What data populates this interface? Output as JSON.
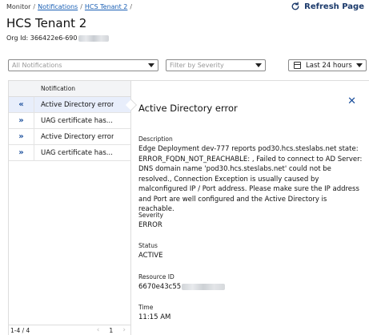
{
  "breadcrumb": {
    "items": [
      "Monitor",
      "Notifications",
      "HCS Tenant 2"
    ],
    "trailing_sep": "/"
  },
  "header": {
    "refresh_label": "Refresh Page",
    "title": "HCS Tenant 2",
    "org_id_label": "Org Id:",
    "org_id_value": "366422e6-690"
  },
  "filters": {
    "notifications_placeholder": "All Notifications",
    "severity_placeholder": "Filter by Severity",
    "time_range": "Last 24 hours"
  },
  "list": {
    "header": "Notification",
    "rows": [
      {
        "label": "Active Directory error",
        "expanded": true
      },
      {
        "label": "UAG certificate has...",
        "expanded": false
      },
      {
        "label": "Active Directory error",
        "expanded": false
      },
      {
        "label": "UAG certificate has...",
        "expanded": false
      }
    ],
    "footer_range": "1-4 / 4",
    "page": "1"
  },
  "detail": {
    "title": "Active Directory error",
    "description_label": "Description",
    "description": "Edge Deployment dev-777 reports pod30.hcs.steslabs.net state: ERROR_FQDN_NOT_REACHABLE: , Failed to connect to AD Server: DNS domain name 'pod30.hcs.steslabs.net' could not be resolved., Connection Exception is usually caused by malconfigured IP / Port address. Please make sure the IP address and Port are well configured and the Active Directory is reachable.",
    "severity_label": "Severity",
    "severity": "ERROR",
    "status_label": "Status",
    "status": "ACTIVE",
    "resource_label": "Resource ID",
    "resource_id": "6670e43c55",
    "time_label": "Time",
    "time": "11:15 AM"
  },
  "colors": {
    "accent": "#1b4f9c",
    "link": "#1a5fb4",
    "active_row": "#e8eefb"
  }
}
